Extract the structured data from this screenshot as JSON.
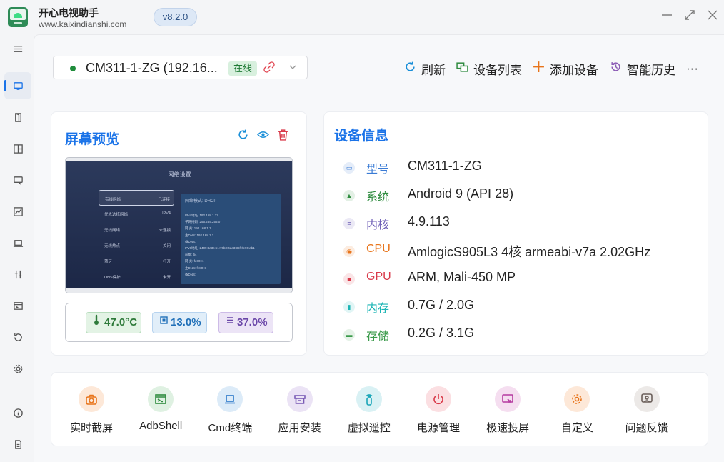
{
  "app": {
    "name": "开心电视助手",
    "url": "www.kaixindianshi.com",
    "version": "v8.2.0"
  },
  "window_controls": [
    "minimize",
    "maximize",
    "close"
  ],
  "sidebar": {
    "items": [
      {
        "icon": "menu-icon",
        "active": false
      },
      {
        "icon": "monitor-icon",
        "active": true
      },
      {
        "icon": "door-icon",
        "active": false
      },
      {
        "icon": "layout-icon",
        "active": false
      },
      {
        "icon": "cast-icon",
        "active": false
      },
      {
        "icon": "chart-icon",
        "active": false
      },
      {
        "icon": "laptop-icon",
        "active": false
      },
      {
        "icon": "tools-icon",
        "active": false
      },
      {
        "icon": "terminal-icon",
        "active": false
      },
      {
        "icon": "history-icon",
        "active": false
      },
      {
        "icon": "settings-icon",
        "active": false
      },
      {
        "icon": "info-icon",
        "active": false
      },
      {
        "icon": "document-icon",
        "active": false
      }
    ]
  },
  "device_selector": {
    "name": "CM311-1-ZG (192.16...",
    "status": "在线"
  },
  "toolbar": {
    "refresh": "刷新",
    "device_list": "设备列表",
    "add_device": "添加设备",
    "history": "智能历史",
    "more": "···"
  },
  "preview": {
    "title": "屏幕预览",
    "tv": {
      "title": "网络设置",
      "menu": [
        {
          "k": "有线网络",
          "v": "已连接"
        },
        {
          "k": "优先选择网络",
          "v": "IPV4"
        },
        {
          "k": "无线网络",
          "v": "未连接"
        },
        {
          "k": "无线热点",
          "v": "关闭"
        },
        {
          "k": "蓝牙",
          "v": "打开"
        },
        {
          "k": "DNS保护",
          "v": "未开"
        }
      ],
      "panel_head": "网络模式: DHCP",
      "panel_rows": [
        "IPv4地址:   192.168.1.72",
        "子网掩码:   255.255.255.0",
        "网    关:   192.168.1.1",
        "主DNS:   192.168.1.1",
        "备DNS:",
        "IPv6地址:   2409:8a3c:b1:70b0:4ae3:36ff:fe90:ab1",
        "前缀:   64",
        "网    关:   fe80::1",
        "主DNS:   fe80::1",
        "备DNS:"
      ]
    },
    "stats": {
      "temperature": "47.0°C",
      "cpu": "13.0%",
      "memory": "37.0%"
    }
  },
  "device_info": {
    "title": "设备信息",
    "rows": [
      {
        "key": "型号",
        "value": "CM311-1-ZG",
        "color": "#3a7bd5"
      },
      {
        "key": "系统",
        "value": "Android 9 (API 28)",
        "color": "#2e8b3e"
      },
      {
        "key": "内核",
        "value": "4.9.113",
        "color": "#6b5bb5"
      },
      {
        "key": "CPU",
        "value": "AmlogicS905L3 4核 armeabi-v7a 2.02GHz",
        "color": "#e8741a"
      },
      {
        "key": "GPU",
        "value": "ARM, Mali-450 MP",
        "color": "#d93a4a"
      },
      {
        "key": "内存",
        "value": "0.7G / 2.0G",
        "color": "#1db5b5"
      },
      {
        "key": "存储",
        "value": "0.2G / 3.1G",
        "color": "#3a9a4a"
      }
    ]
  },
  "tools": [
    {
      "label": "实时截屏",
      "icon": "camera-icon",
      "color": "#e8741a",
      "bg": "#fde8d8"
    },
    {
      "label": "AdbShell",
      "icon": "terminal-icon",
      "color": "#2e8b3e",
      "bg": "#dff1e2"
    },
    {
      "label": "Cmd终端",
      "icon": "laptop-icon",
      "color": "#2a78c8",
      "bg": "#dcebf8"
    },
    {
      "label": "应用安装",
      "icon": "box-icon",
      "color": "#7a5bb5",
      "bg": "#ebe3f5"
    },
    {
      "label": "虚拟遥控",
      "icon": "remote-icon",
      "color": "#1aa6b8",
      "bg": "#d9f1f4"
    },
    {
      "label": "电源管理",
      "icon": "power-icon",
      "color": "#d93a4a",
      "bg": "#fbdfe2"
    },
    {
      "label": "极速投屏",
      "icon": "cast-icon",
      "color": "#b53aa0",
      "bg": "#f5def0"
    },
    {
      "label": "自定义",
      "icon": "gear-icon",
      "color": "#e8741a",
      "bg": "#fde8d8"
    },
    {
      "label": "问题反馈",
      "icon": "feedback-icon",
      "color": "#6b5f5a",
      "bg": "#ece9e7"
    }
  ]
}
